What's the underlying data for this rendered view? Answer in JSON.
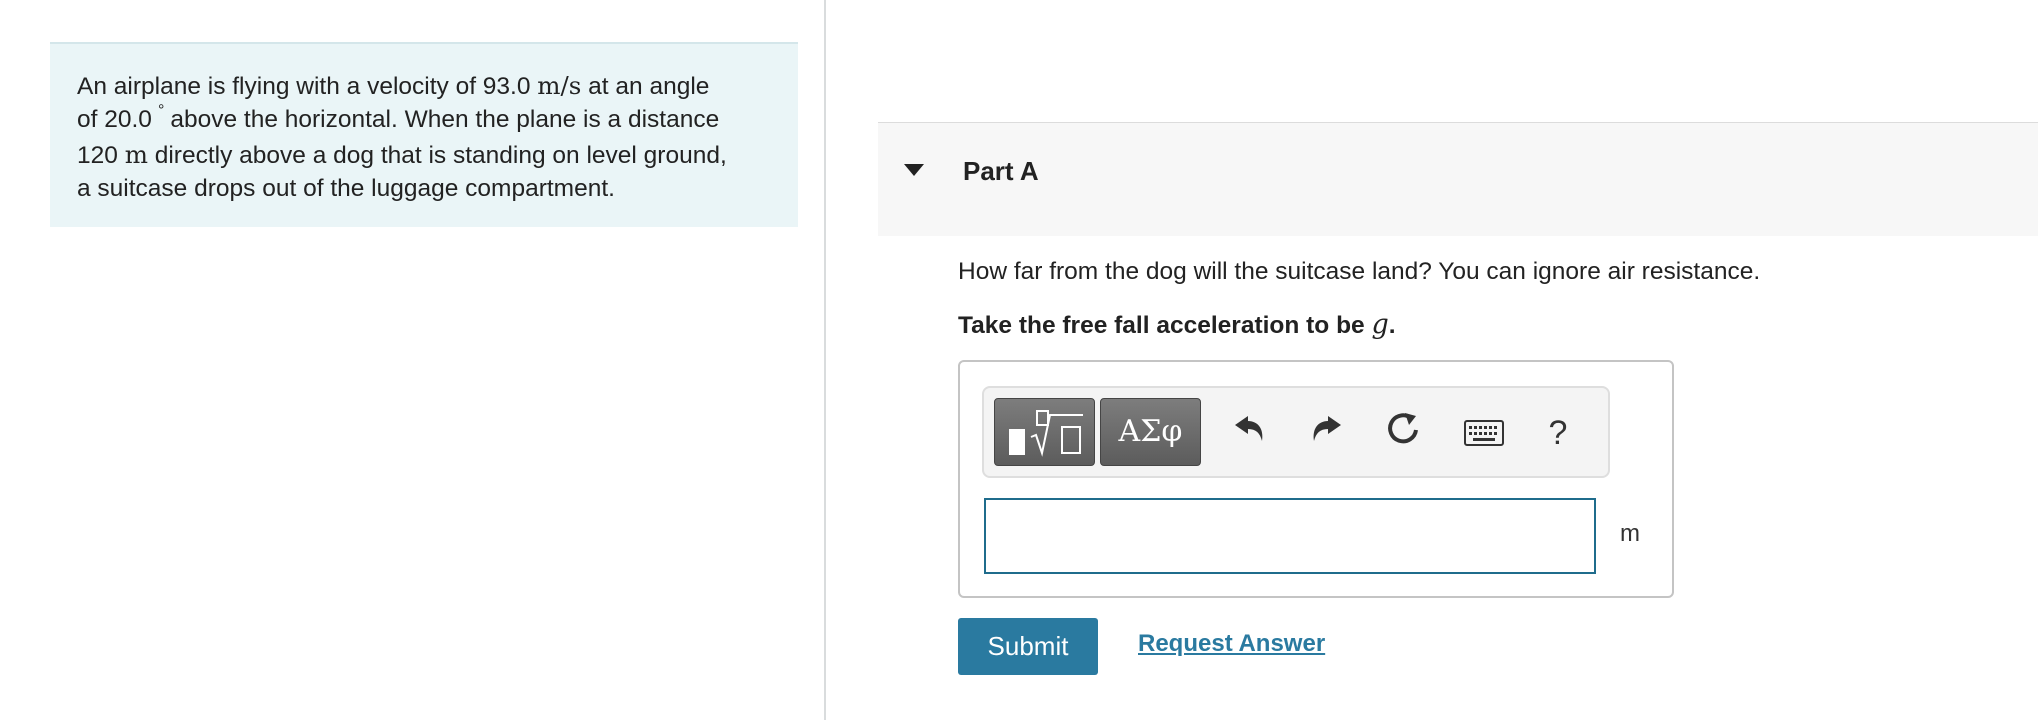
{
  "problem": {
    "line1_pre": "An airplane is flying with a velocity of 93.0 ",
    "line1_unit": "m/s",
    "line1_post": " at an angle",
    "line2_pre": "of 20.0",
    "degree": "°",
    "line2_post": "above the horizontal. When the plane is a distance",
    "line3_pre": "120 ",
    "line3_unit": "m",
    "line3_post": " directly above a dog that is standing on level ground,",
    "line4": "a suitcase drops out of the luggage compartment."
  },
  "part": {
    "title": "Part A",
    "question": "How far from the dog will the suitcase land? You can ignore air resistance.",
    "instruction_pre": "Take the free fall acceleration to be ",
    "instruction_var": "g",
    "instruction_post": "."
  },
  "toolbar": {
    "symbols_label": "ΑΣφ",
    "help_label": "?",
    "icons": [
      "templates-icon",
      "greek-symbols-icon",
      "undo-icon",
      "redo-icon",
      "reset-icon",
      "keyboard-icon",
      "help-icon"
    ]
  },
  "answer": {
    "value": "",
    "unit": "m"
  },
  "actions": {
    "submit_label": "Submit",
    "request_answer_label": "Request Answer"
  },
  "colors": {
    "problem_bg": "#eaf5f7",
    "accent": "#2a7aa0",
    "input_border": "#1f6c8c",
    "toolbar_button": "#6b6b6b"
  }
}
